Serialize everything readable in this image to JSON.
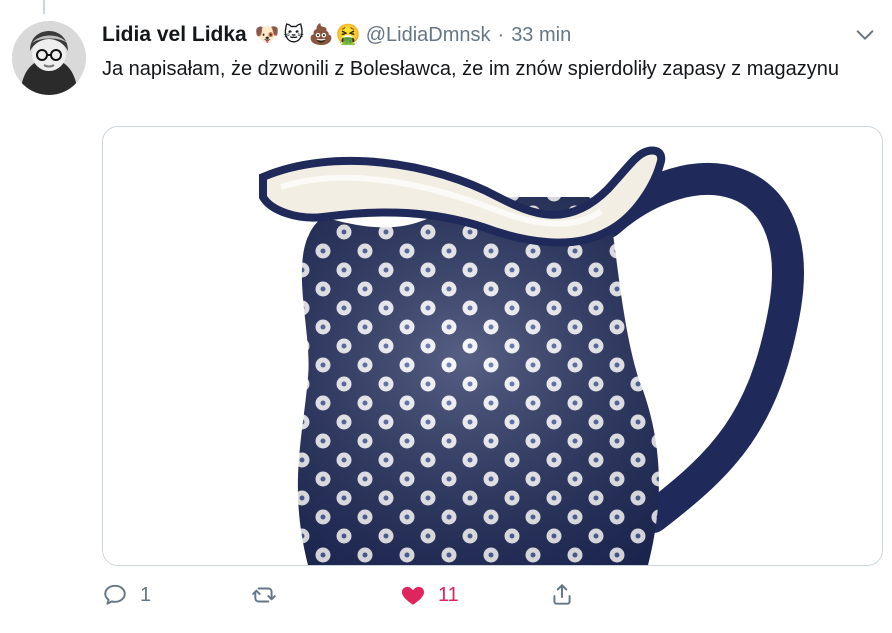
{
  "tweet": {
    "author_name": "Lidia vel Lidka",
    "author_emojis": [
      {
        "icon": "dog-face",
        "glyph": "🐶"
      },
      {
        "icon": "cat-face",
        "glyph": "🐱"
      },
      {
        "icon": "pile-of-poo",
        "glyph": "💩"
      },
      {
        "icon": "nauseated-face",
        "glyph": "🤮"
      }
    ],
    "handle": "@LidiaDmnsk",
    "separator": "·",
    "time": "33 min",
    "text": "Ja napisałam, że dzwonili z Bolesławca, że im znów spierdoliły zapasy z magazynu",
    "media": {
      "description_icon": "polka-dot-pitcher-image"
    },
    "actions": {
      "reply_count": "1",
      "retweet_count": "",
      "like_count": "11"
    }
  },
  "colors": {
    "text_primary": "#14171a",
    "text_secondary": "#657786",
    "like_red": "#e0245e",
    "border": "#ccd6dd",
    "pottery_blue": "#1f2a5a"
  }
}
